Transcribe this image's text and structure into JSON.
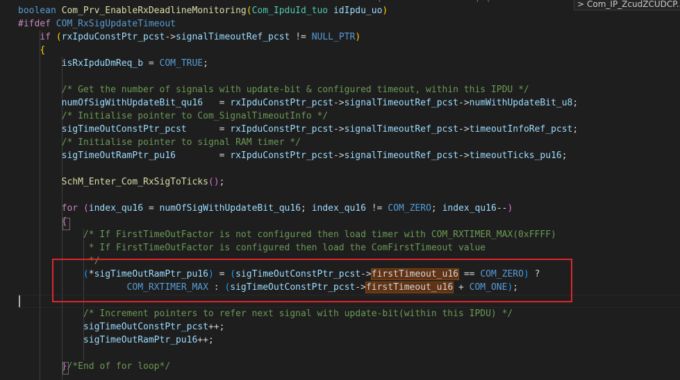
{
  "editor": {
    "top_partial_text": "                                                                  (                 ) (                       )",
    "tab_hint": {
      "chevron": ">",
      "label": "Com_IP_ZcudZCUDCP..."
    },
    "lines": [
      {
        "tokens": [
          [
            "kw",
            "boolean"
          ],
          [
            "p",
            " "
          ],
          [
            "fn",
            "Com_Prv_EnableRxDeadlineMonitoring"
          ],
          [
            "br1",
            "("
          ],
          [
            "ty",
            "Com_IpduId_tuo"
          ],
          [
            "p",
            " "
          ],
          [
            "var",
            "idIpdu_uo"
          ],
          [
            "br1",
            ")"
          ]
        ]
      },
      {
        "tokens": [
          [
            "ctl",
            "#ifdef"
          ],
          [
            "p",
            " "
          ],
          [
            "mac",
            "COM_RxSigUpdateTimeout"
          ]
        ]
      },
      {
        "tokens": [
          [
            "p",
            "    "
          ],
          [
            "ctl",
            "if"
          ],
          [
            "p",
            " "
          ],
          [
            "br1",
            "("
          ],
          [
            "var",
            "rxIpduConstPtr_pcst"
          ],
          [
            "p",
            "->"
          ],
          [
            "var",
            "signalTimeoutRef_pcst"
          ],
          [
            "p",
            " != "
          ],
          [
            "mac",
            "NULL_PTR"
          ],
          [
            "br1",
            ")"
          ]
        ]
      },
      {
        "tokens": [
          [
            "p",
            "    "
          ],
          [
            "br1",
            "{"
          ]
        ]
      },
      {
        "tokens": [
          [
            "p",
            "        "
          ],
          [
            "var",
            "isRxIpduDmReq_b"
          ],
          [
            "p",
            " = "
          ],
          [
            "mac",
            "COM_TRUE"
          ],
          [
            "p",
            ";"
          ]
        ]
      },
      {
        "tokens": []
      },
      {
        "tokens": [
          [
            "p",
            "        "
          ],
          [
            "cm",
            "/* Get the number of signals with update-bit & configured timeout, within this IPDU */"
          ]
        ]
      },
      {
        "tokens": [
          [
            "p",
            "        "
          ],
          [
            "var",
            "numOfSigWithUpdateBit_qu16"
          ],
          [
            "p",
            "   = "
          ],
          [
            "var",
            "rxIpduConstPtr_pcst"
          ],
          [
            "p",
            "->"
          ],
          [
            "var",
            "signalTimeoutRef_pcst"
          ],
          [
            "p",
            "->"
          ],
          [
            "var",
            "numWithUpdateBit_u8"
          ],
          [
            "p",
            ";"
          ]
        ]
      },
      {
        "tokens": [
          [
            "p",
            "        "
          ],
          [
            "cm",
            "/* Initialise pointer to Com_SignalTimeoutInfo */"
          ]
        ]
      },
      {
        "tokens": [
          [
            "p",
            "        "
          ],
          [
            "var",
            "sigTimeOutConstPtr_pcst"
          ],
          [
            "p",
            "      = "
          ],
          [
            "var",
            "rxIpduConstPtr_pcst"
          ],
          [
            "p",
            "->"
          ],
          [
            "var",
            "signalTimeoutRef_pcst"
          ],
          [
            "p",
            "->"
          ],
          [
            "var",
            "timeoutInfoRef_pcst"
          ],
          [
            "p",
            ";"
          ]
        ]
      },
      {
        "tokens": [
          [
            "p",
            "        "
          ],
          [
            "cm",
            "/* Initialise pointer to signal RAM timer */"
          ]
        ]
      },
      {
        "tokens": [
          [
            "p",
            "        "
          ],
          [
            "var",
            "sigTimeOutRamPtr_pu16"
          ],
          [
            "p",
            "        = "
          ],
          [
            "var",
            "rxIpduConstPtr_pcst"
          ],
          [
            "p",
            "->"
          ],
          [
            "var",
            "signalTimeoutRef_pcst"
          ],
          [
            "p",
            "->"
          ],
          [
            "var",
            "timeoutTicks_pu16"
          ],
          [
            "p",
            ";"
          ]
        ]
      },
      {
        "tokens": []
      },
      {
        "tokens": [
          [
            "p",
            "        "
          ],
          [
            "fn",
            "SchM_Enter_Com_RxSigToTicks"
          ],
          [
            "br2",
            "()"
          ],
          [
            "p",
            ";"
          ]
        ]
      },
      {
        "tokens": []
      },
      {
        "tokens": [
          [
            "p",
            "        "
          ],
          [
            "ctl",
            "for"
          ],
          [
            "p",
            " "
          ],
          [
            "br2",
            "("
          ],
          [
            "var",
            "index_qu16"
          ],
          [
            "p",
            " = "
          ],
          [
            "var",
            "numOfSigWithUpdateBit_qu16"
          ],
          [
            "p",
            "; "
          ],
          [
            "var",
            "index_qu16"
          ],
          [
            "p",
            " != "
          ],
          [
            "mac",
            "COM_ZERO"
          ],
          [
            "p",
            "; "
          ],
          [
            "var",
            "index_qu16"
          ],
          [
            "p",
            "--"
          ],
          [
            "br2",
            ")"
          ]
        ]
      },
      {
        "tokens": [
          [
            "p",
            "        "
          ],
          [
            "br2",
            "{"
          ]
        ]
      },
      {
        "tokens": [
          [
            "p",
            "            "
          ],
          [
            "cm",
            "/* If FirstTimeOutFactor is not configured then load timer with COM_RXTIMER_MAX(0xFFFF)"
          ]
        ]
      },
      {
        "tokens": [
          [
            "p",
            "             "
          ],
          [
            "cm",
            "* If FirstTimeOutFactor is configured then load the ComFirstTimeout value"
          ]
        ]
      },
      {
        "tokens": [
          [
            "p",
            "             "
          ],
          [
            "cm",
            "*/"
          ]
        ]
      },
      {
        "tokens": [
          [
            "p",
            "            "
          ],
          [
            "br3",
            "("
          ],
          [
            "p",
            "*"
          ],
          [
            "var",
            "sigTimeOutRamPtr_pu16"
          ],
          [
            "br3",
            ")"
          ],
          [
            "p",
            " = "
          ],
          [
            "br3",
            "("
          ],
          [
            "var",
            "sigTimeOutConstPtr_pcst"
          ],
          [
            "p",
            "->"
          ],
          [
            "hl",
            "firstTimeout_u16"
          ],
          [
            "p",
            " == "
          ],
          [
            "mac",
            "COM_ZERO"
          ],
          [
            "br3",
            ")"
          ],
          [
            "p",
            " ?"
          ]
        ]
      },
      {
        "tokens": [
          [
            "p",
            "                    "
          ],
          [
            "mac",
            "COM_RXTIMER_MAX"
          ],
          [
            "p",
            " : "
          ],
          [
            "br3",
            "("
          ],
          [
            "var",
            "sigTimeOutConstPtr_pcst"
          ],
          [
            "p",
            "->"
          ],
          [
            "hl",
            "firstTimeout_u16"
          ],
          [
            "p",
            " + "
          ],
          [
            "mac",
            "COM_ONE"
          ],
          [
            "br3",
            ")"
          ],
          [
            "p",
            ";"
          ]
        ]
      },
      {
        "tokens": []
      },
      {
        "tokens": [
          [
            "p",
            "            "
          ],
          [
            "cm",
            "/* Increment pointers to refer next signal with update-bit(within this IPDU) */"
          ]
        ]
      },
      {
        "tokens": [
          [
            "p",
            "            "
          ],
          [
            "var",
            "sigTimeOutConstPtr_pcst"
          ],
          [
            "p",
            "++;"
          ]
        ]
      },
      {
        "tokens": [
          [
            "p",
            "            "
          ],
          [
            "var",
            "sigTimeOutRamPtr_pu16"
          ],
          [
            "p",
            "++;"
          ]
        ]
      },
      {
        "tokens": []
      },
      {
        "tokens": [
          [
            "p",
            "        "
          ],
          [
            "br2",
            "}"
          ],
          [
            "cm",
            "/*End of for loop*/"
          ]
        ]
      }
    ]
  }
}
